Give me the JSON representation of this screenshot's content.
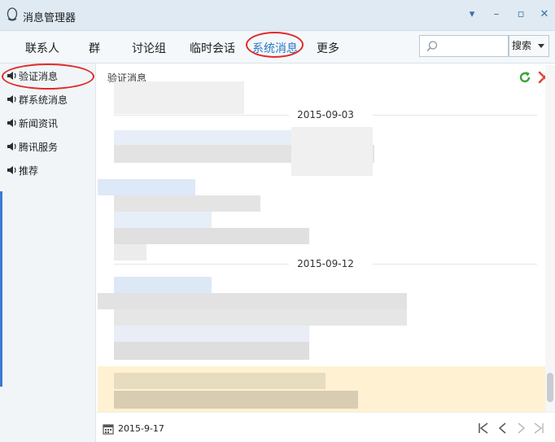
{
  "window": {
    "title": "消息管理器"
  },
  "tabs": [
    {
      "label": "联系人"
    },
    {
      "label": "群"
    },
    {
      "label": "讨论组"
    },
    {
      "label": "临时会话"
    },
    {
      "label": "系统消息"
    },
    {
      "label": "更多"
    }
  ],
  "search": {
    "placeholder": "",
    "button_label": "搜索"
  },
  "sidebar": {
    "items": [
      {
        "label": "验证消息"
      },
      {
        "label": "群系统消息"
      },
      {
        "label": "新闻资讯"
      },
      {
        "label": "腾讯服务"
      },
      {
        "label": "推荐"
      }
    ]
  },
  "content": {
    "title": "验证消息",
    "date_separators": [
      "2015-09-03",
      "2015-09-12"
    ]
  },
  "footer": {
    "date": "2015-9-17"
  },
  "colors": {
    "accent": "#2b78c5",
    "annotation_circle": "#e02a2a",
    "highlight_row": "#fff1d2",
    "titlebar_bg": "#dfeaf3"
  },
  "icons": {
    "window_logo": "penguin-icon",
    "search": "search-icon",
    "refresh": "refresh-icon",
    "delete": "close-icon",
    "calendar": "calendar-icon",
    "pager": [
      "first-page-icon",
      "prev-page-icon",
      "next-page-icon",
      "last-page-icon"
    ]
  }
}
